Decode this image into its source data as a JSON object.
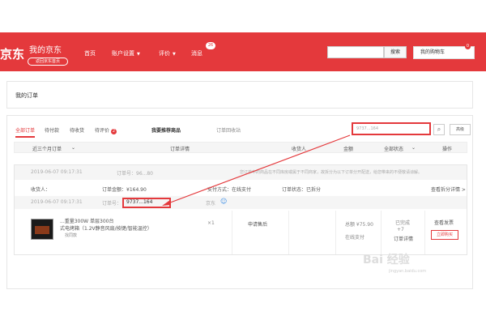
{
  "header": {
    "logo": "京东",
    "brand_title": "我的京东",
    "home_link": "返回京东首页",
    "nav": [
      "首页",
      "账户设置",
      "评价",
      "消息"
    ],
    "message_count": "26",
    "search_button": "搜索",
    "cart_label": "我的购物车",
    "cart_count": "0"
  },
  "panel": {
    "title": "我的订单"
  },
  "tabs": {
    "all": "全部订单",
    "to_pay": "待付款",
    "to_receive": "待收货",
    "to_review": "待评价",
    "review_badge": "2",
    "not_on_way": "我要推荐商品",
    "recycle": "订单回收站"
  },
  "order_search": {
    "value": "9737...164",
    "advanced": "高级"
  },
  "columns": {
    "recent": "近三个月订单",
    "detail": "订单详情",
    "consignee": "收货人",
    "amount": "金额",
    "status": "全部状态",
    "actions": "操作"
  },
  "order1": {
    "time": "2019-06-07 09:17:31",
    "order_no": "订单号：96...80",
    "notice": "您订单中的商品在不同库房或属于不同商家，故拆分为以下订单分开配送，给您带来的不便敬请谅解。"
  },
  "order2": {
    "consignee": "收货人：",
    "amount": "订单金额：¥164.90",
    "pay": "支付方式：在线支付",
    "status": "订单状态：已拆分",
    "view_split": "查看拆分详情 >"
  },
  "order3": {
    "time": "2019-06-07 09:17:31",
    "order_no_label": "订单号：",
    "order_no": "9737...164",
    "shop": "京东"
  },
  "goods": {
    "title_line1": "...重量300W 单层300台",
    "title_line2": "式电烤箱（1.2V静音风扇/按键/智能温控）",
    "tag": "找同款",
    "qty": "×1",
    "service": "申请售后",
    "price": "总额 ¥75.90",
    "pay_type": "在线支付",
    "status": "已完成",
    "order_detail": "订单详情",
    "view_invoice": "查看发票",
    "buy_again": "立即购买",
    "plus_count": "+7"
  },
  "watermark": {
    "text": "Bai 经验",
    "url": "jingyan.baidu.com"
  },
  "colors": {
    "brand": "#e4393c"
  }
}
